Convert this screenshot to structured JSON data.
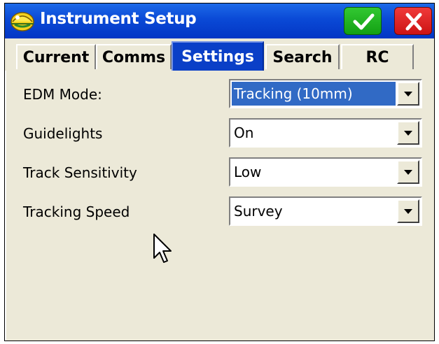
{
  "window": {
    "title": "Instrument Setup"
  },
  "titlebar": {
    "app_icon": "surveyor-helmet-icon",
    "ok_icon": "checkmark-icon",
    "close_icon": "close-x-icon"
  },
  "tabs": [
    {
      "label": "Current"
    },
    {
      "label": "Comms"
    },
    {
      "label": "Settings",
      "active": true
    },
    {
      "label": "Search"
    },
    {
      "label": "RC"
    }
  ],
  "settings": [
    {
      "label": "EDM Mode:",
      "value": "Tracking (10mm)"
    },
    {
      "label": "Guidelights",
      "value": "On"
    },
    {
      "label": "Track Sensitivity",
      "value": "Low"
    },
    {
      "label": "Tracking Speed",
      "value": "Survey"
    }
  ],
  "colors": {
    "titlebar": "#0a49d6",
    "active_tab": "#0a3fc7",
    "ok_button": "#22b422",
    "close_button": "#e02020",
    "selection": "#316ac5"
  }
}
